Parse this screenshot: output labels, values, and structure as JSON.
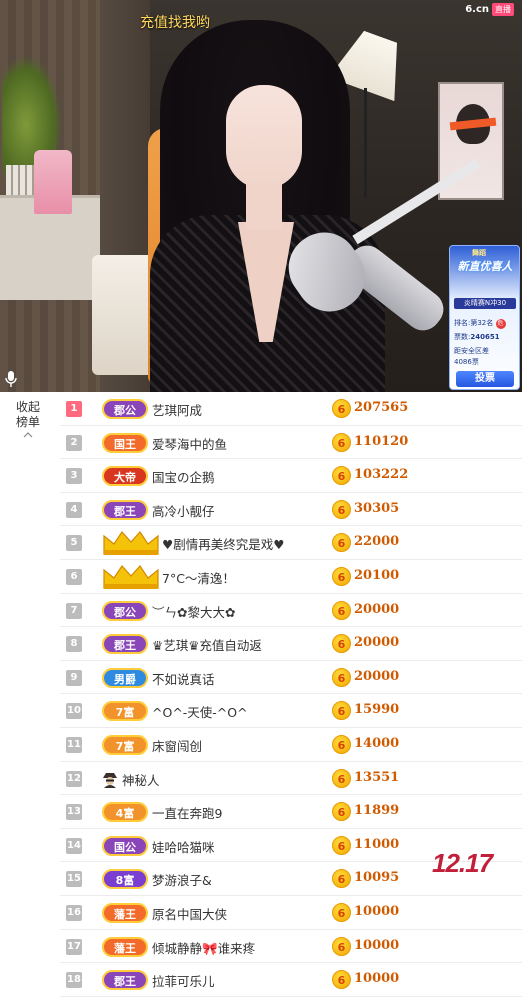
{
  "stream": {
    "overlay_title": "充值找我哟",
    "logo": "6.cn",
    "logo_tag": "直播"
  },
  "vote_card": {
    "tag": "舞蹈",
    "title": "新直优喜人",
    "ribbon": "炎晴赛N冲30",
    "rank_line": "排名:第32名",
    "rank_badge": "危",
    "votes_label": "票数:",
    "votes_value": "240651",
    "distance_label": "距安全区差",
    "distance_value": "4086票",
    "button": "投票"
  },
  "ranking": {
    "collapse_label": "收起榜单",
    "rows": [
      {
        "rank": "1",
        "badge": "郡公",
        "badge_color": "#8a46b8",
        "name": "艺琪阿成",
        "amount": "207565"
      },
      {
        "rank": "2",
        "badge": "国王",
        "badge_color": "#f26b2a",
        "name": "爱琴海中的鱼",
        "amount": "110120"
      },
      {
        "rank": "3",
        "badge": "大帝",
        "badge_color": "#d9361f",
        "name": "国宝の企鹅",
        "amount": "103222"
      },
      {
        "rank": "4",
        "badge": "郡王",
        "badge_color": "#8a46b8",
        "name": "高冷小靓仔",
        "amount": "30305"
      },
      {
        "rank": "5",
        "badge": "",
        "badge_color": "#f5c20a",
        "name": "♥剧情再美终究是戏♥",
        "amount": "22000"
      },
      {
        "rank": "6",
        "badge": "",
        "badge_color": "#f5c20a",
        "name": "7°C～清逸！",
        "amount": "20100"
      },
      {
        "rank": "7",
        "badge": "郡公",
        "badge_color": "#8a46b8",
        "name": "︶ㄣ✿黎大大✿",
        "amount": "20000"
      },
      {
        "rank": "8",
        "badge": "郡王",
        "badge_color": "#8a46b8",
        "name": "♛艺琪♛充值自动返",
        "amount": "20000"
      },
      {
        "rank": "9",
        "badge": "男爵",
        "badge_color": "#2e8be0",
        "name": "不如说真话",
        "amount": "20000"
      },
      {
        "rank": "10",
        "badge": "7富",
        "badge_color": "#f2922a",
        "name": "^O^-天使-^O^",
        "amount": "15990"
      },
      {
        "rank": "11",
        "badge": "7富",
        "badge_color": "#f2922a",
        "name": "床窗闯创",
        "amount": "14000"
      },
      {
        "rank": "12",
        "badge": "",
        "badge_color": "",
        "name": "神秘人",
        "amount": "13551"
      },
      {
        "rank": "13",
        "badge": "4富",
        "badge_color": "#f2922a",
        "name": "一直在奔跑9",
        "amount": "11899"
      },
      {
        "rank": "14",
        "badge": "国公",
        "badge_color": "#8a46b8",
        "name": "娃哈哈猫咪",
        "amount": "11000"
      },
      {
        "rank": "15",
        "badge": "8富",
        "badge_color": "#7a3ed0",
        "name": "梦游浪子&",
        "amount": "10095"
      },
      {
        "rank": "16",
        "badge": "藩王",
        "badge_color": "#f26b2a",
        "name": "原名中国大侠",
        "amount": "10000"
      },
      {
        "rank": "17",
        "badge": "藩王",
        "badge_color": "#f26b2a",
        "name": "倾城静静🎀谁来疼",
        "amount": "10000"
      },
      {
        "rank": "18",
        "badge": "郡王",
        "badge_color": "#8a46b8",
        "name": "拉菲可乐儿",
        "amount": "10000"
      }
    ],
    "coin_glyph": "6"
  },
  "watermark": "12.17",
  "colors": {
    "amount": "#cf5a00",
    "rank_first": "#ff6a7f",
    "rank_default": "#bcbcbc",
    "vote_button": "#2558e0"
  }
}
